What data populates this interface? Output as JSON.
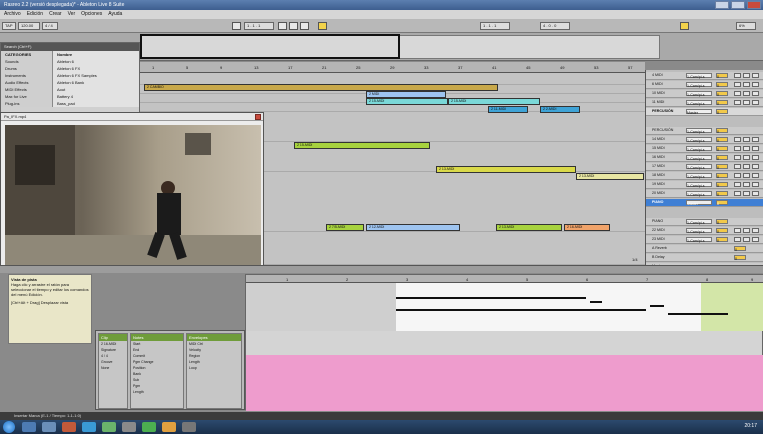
{
  "window": {
    "title": "Rasreo 2.2 (versió desplegada)* - Ableton Live 8 Suite"
  },
  "menu": [
    "Archivo",
    "Edición",
    "Crear",
    "Ver",
    "Opciones",
    "Ayuda"
  ],
  "transport": {
    "tempo_label": "TAP",
    "bpm": "120.00",
    "signature": "4 / 4",
    "position": "1 . 1 . 1",
    "loop_length": "4 . 0 . 0",
    "cpu": "6%"
  },
  "browser": {
    "search_placeholder": "Search (Ctrl+F)",
    "categories_header": "CATEGORIES",
    "name_header": "Nombre",
    "categories": [
      "Sounds",
      "Drums",
      "Instruments",
      "Audio Effects",
      "MIDI Effects",
      "Max for Live",
      "Plug-ins"
    ],
    "items": [
      "Ableton 6",
      "Ableton 6 FX",
      "Ableton 6 FX Samples",
      "Ableton 6 Bank",
      "Aout",
      "Battery 4",
      "Bass_pad"
    ]
  },
  "video": {
    "title": "Pa_IFX.mp4"
  },
  "arrangement": {
    "bars": [
      "1",
      "5",
      "9",
      "13",
      "17",
      "21",
      "25",
      "29",
      "33",
      "37",
      "41",
      "45",
      "49",
      "53",
      "57"
    ],
    "clips": [
      {
        "label": "2 CAMBIO",
        "color": "#c8a84a"
      },
      {
        "label": "2 MIDI",
        "color": "#9ec4f0"
      },
      {
        "label": "2 15-MIDI",
        "color": "#7ad8d8"
      },
      {
        "label": "2 15-MIDI",
        "color": "#7ad8d8"
      },
      {
        "label": "2 11-MIDI",
        "color": "#3fa3d6"
      },
      {
        "label": "2 2-MIDI",
        "color": "#3fa3d6"
      },
      {
        "label": "2 15-MIDI",
        "color": "#a7d23e"
      },
      {
        "label": "2 13-MIDI",
        "color": "#d9d94a"
      },
      {
        "label": "2 13-MIDI",
        "color": "#e8e6a3"
      },
      {
        "label": "2 7/5-MIDI",
        "color": "#a7d23e"
      },
      {
        "label": "2 12-MIDI",
        "color": "#9ec4f0"
      },
      {
        "label": "2 13-MIDI",
        "color": "#a7d23e"
      },
      {
        "label": "2 16-MIDI",
        "color": "#f0a36a"
      }
    ]
  },
  "mixer": {
    "tracks": [
      {
        "name": "4 MIDI",
        "io": "1-Cam/pi-s",
        "vol": "0"
      },
      {
        "name": "6 MIDI",
        "io": "1-Cam/pi-s",
        "vol": "0"
      },
      {
        "name": "10 MIDI",
        "io": "1-Cam/pi-s",
        "vol": "0"
      },
      {
        "name": "11 MIDI",
        "io": "1-Cam/pi-s",
        "vol": "0"
      },
      {
        "name": "PERCUSIÓN",
        "io": "Master",
        "vol": "0"
      },
      {
        "name": "PERCUSIÓN",
        "io": "1-Cam/pi-s",
        "vol": "0"
      },
      {
        "name": "14 MIDI",
        "io": "1-Cam/pi-s",
        "vol": "0"
      },
      {
        "name": "15 MIDI",
        "io": "1-Cam/pi-s",
        "vol": "0"
      },
      {
        "name": "16 MIDI",
        "io": "1-Cam/pi-s",
        "vol": "0"
      },
      {
        "name": "17 MIDI",
        "io": "1-Cam/pi-s",
        "vol": "0"
      },
      {
        "name": "18 MIDI",
        "io": "1-Cam/pi-s",
        "vol": "0"
      },
      {
        "name": "19 MIDI",
        "io": "1-Cam/pi-s",
        "vol": "0"
      },
      {
        "name": "20 MIDI",
        "io": "1-Cam/pi-s",
        "vol": "0"
      },
      {
        "name": "PIANO",
        "io": "Master",
        "vol": "0"
      },
      {
        "name": "PIANO",
        "io": "1-Cam/pi-s",
        "vol": "0"
      },
      {
        "name": "22 MIDI",
        "io": "1-Cam/pi-s",
        "vol": "0"
      },
      {
        "name": "23 MIDI",
        "io": "1-Cam/pi-s",
        "vol": "0"
      },
      {
        "name": "A Reverb",
        "io": "",
        "vol": "0"
      },
      {
        "name": "B Delay",
        "io": "",
        "vol": "0"
      },
      {
        "name": "Master",
        "io": "1/2",
        "vol": "0"
      }
    ],
    "page_indicator": "1/4"
  },
  "info": {
    "title": "Vista de pista",
    "body": "Haga clic y arrastre el ratón para seleccionar el tiempo y editar los comandos del menú Edición.",
    "hint": "[Ctrl+Alt + Drag] Desplazar vista"
  },
  "clipview": {
    "clip": {
      "header": "Clip",
      "name": "2 16-MIDI",
      "signature": "Signature",
      "sig_val": "4 / 4",
      "groove": "Groove",
      "none": "None"
    },
    "notes": {
      "header": "Notes",
      "start": "Start",
      "end": "End",
      "position": "Position",
      "length": "Length",
      "pgm_change": "Pgm Change",
      "bank": "Bank",
      "sub": "Sub",
      "pgm": "Pgm",
      "commit": "Commit"
    },
    "envelopes": {
      "header": "Envelopes",
      "device": "MIDI Ctrl",
      "param": "Velocity",
      "region": "Region",
      "length": "Length",
      "loop": "Loop"
    }
  },
  "pianoroll": {
    "bars": [
      "1",
      "2",
      "3",
      "4",
      "5",
      "6",
      "7",
      "8",
      "9"
    ]
  },
  "statusbar": {
    "text": "Insertar Marca (E-1 / Tiempo: 1-1-1:0)"
  },
  "taskbar": {
    "clock": "20:17"
  }
}
